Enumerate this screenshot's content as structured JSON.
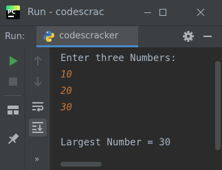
{
  "window": {
    "title": "Run - codescrac",
    "app_logo_text": "PC"
  },
  "run_panel": {
    "label": "Run:",
    "tab_label": "codescracker"
  },
  "console": {
    "lines": [
      {
        "text": "Enter three Numbers:",
        "kind": "output"
      },
      {
        "text": "10",
        "kind": "input"
      },
      {
        "text": "20",
        "kind": "input"
      },
      {
        "text": "30",
        "kind": "input"
      },
      {
        "text": "",
        "kind": "blank"
      },
      {
        "text": "Largest Number = 30",
        "kind": "output"
      }
    ]
  },
  "toolbar": {
    "more_label": "»"
  },
  "colors": {
    "background": "#2b2b2b",
    "panel": "#3c3f41",
    "output_text": "#a9b7c6",
    "input_text": "#cc7832",
    "run_green": "#499c54",
    "tab_underline": "#4a88c7"
  },
  "icons": [
    "pycharm-logo-icon",
    "minimize-icon",
    "maximize-icon",
    "close-icon",
    "python-icon",
    "gear-icon",
    "hide-icon",
    "run-icon",
    "stop-icon",
    "layout-icon",
    "pin-icon",
    "up-arrow-icon",
    "down-arrow-icon",
    "soft-wrap-icon",
    "scroll-to-end-icon"
  ]
}
